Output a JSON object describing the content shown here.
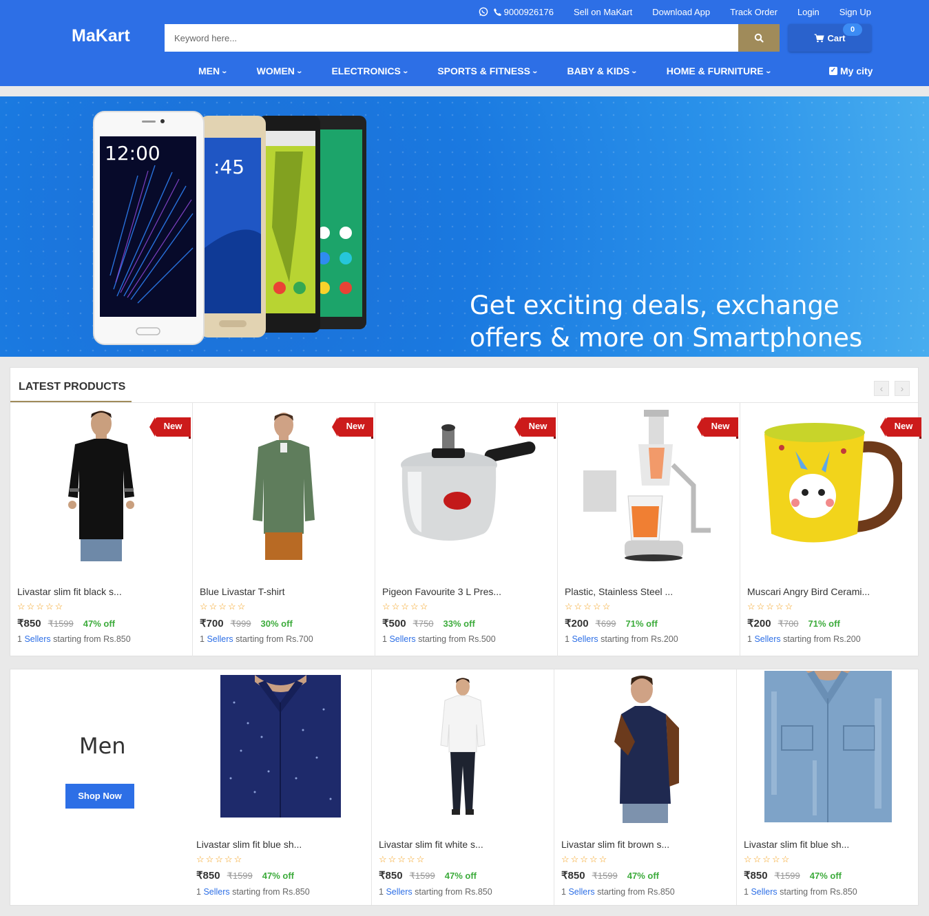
{
  "header": {
    "logo": "MaKart",
    "phone": "9000926176",
    "links": [
      "Sell on MaKart",
      "Download App",
      "Track Order",
      "Login",
      "Sign Up"
    ],
    "search_placeholder": "Keyword here...",
    "cart_label": "Cart",
    "cart_count": "0",
    "nav": [
      "MEN",
      "WOMEN",
      "ELECTRONICS",
      "SPORTS & FITNESS",
      "BABY & KIDS",
      "HOME & FURNITURE"
    ],
    "my_city": "My city"
  },
  "banner": {
    "heading": "Get exciting deals, exchange offers & more on Smartphones",
    "slide_count": 6,
    "active_slide": 1
  },
  "latest": {
    "title": "LATEST PRODUCTS",
    "products": [
      {
        "name": "Livastar slim fit black s...",
        "badge": "New",
        "price": "₹850",
        "mrp": "₹1599",
        "off": "47% off",
        "sellers_count": "1",
        "sellers_word": "Sellers",
        "sellers_rest": " starting from Rs.850",
        "rating": 0
      },
      {
        "name": "Blue Livastar T-shirt",
        "badge": "New",
        "price": "₹700",
        "mrp": "₹999",
        "off": "30% off",
        "sellers_count": "1",
        "sellers_word": "Sellers",
        "sellers_rest": " starting from Rs.700",
        "rating": 0
      },
      {
        "name": "Pigeon Favourite 3 L Pres...",
        "badge": "New",
        "price": "₹500",
        "mrp": "₹750",
        "off": "33% off",
        "sellers_count": "1",
        "sellers_word": "Sellers",
        "sellers_rest": " starting from Rs.500",
        "rating": 0
      },
      {
        "name": "Plastic, Stainless Steel ...",
        "badge": "New",
        "price": "₹200",
        "mrp": "₹699",
        "off": "71% off",
        "sellers_count": "1",
        "sellers_word": "Sellers",
        "sellers_rest": " starting from Rs.200",
        "rating": 0
      },
      {
        "name": "Muscari Angry Bird Cerami...",
        "badge": "New",
        "price": "₹200",
        "mrp": "₹700",
        "off": "71% off",
        "sellers_count": "1",
        "sellers_word": "Sellers",
        "sellers_rest": " starting from Rs.200",
        "rating": 0
      }
    ]
  },
  "men": {
    "title": "Men",
    "shop_now": "Shop Now",
    "products": [
      {
        "name": "Livastar slim fit blue sh...",
        "price": "₹850",
        "mrp": "₹1599",
        "off": "47% off",
        "sellers_count": "1",
        "sellers_word": "Sellers",
        "sellers_rest": " starting from Rs.850",
        "rating": 0
      },
      {
        "name": "Livastar slim fit white s...",
        "price": "₹850",
        "mrp": "₹1599",
        "off": "47% off",
        "sellers_count": "1",
        "sellers_word": "Sellers",
        "sellers_rest": " starting from Rs.850",
        "rating": 0
      },
      {
        "name": "Livastar slim fit brown s...",
        "price": "₹850",
        "mrp": "₹1599",
        "off": "47% off",
        "sellers_count": "1",
        "sellers_word": "Sellers",
        "sellers_rest": " starting from Rs.850",
        "rating": 0
      },
      {
        "name": "Livastar slim fit blue sh...",
        "price": "₹850",
        "mrp": "₹1599",
        "off": "47% off",
        "sellers_count": "1",
        "sellers_word": "Sellers",
        "sellers_rest": " starting from Rs.850",
        "rating": 0
      }
    ]
  },
  "icons": {
    "whatsapp": "whatsapp-icon",
    "phone": "phone-icon",
    "search": "search-icon",
    "cart": "cart-icon",
    "checkbox": "checkbox-icon",
    "star": "star-outline-icon"
  },
  "colors": {
    "brand": "#2d6fe6",
    "search_button": "#a08b5a",
    "badge": "#cc1b1b",
    "discount": "#3cab3b",
    "star": "#f39c12"
  }
}
